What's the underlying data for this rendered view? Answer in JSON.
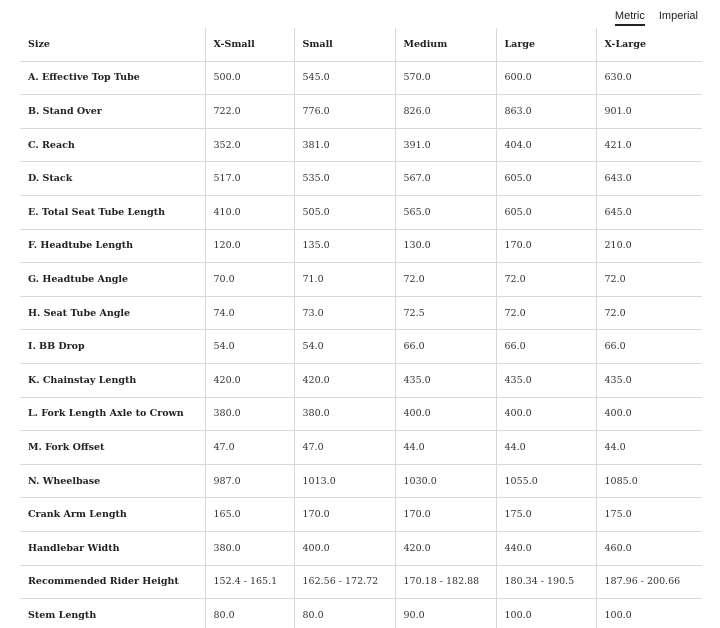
{
  "unit_toggle": {
    "metric": "Metric",
    "imperial": "Imperial",
    "selected": "Metric"
  },
  "table": {
    "header_label": "Size",
    "columns": [
      "X-Small",
      "Small",
      "Medium",
      "Large",
      "X-Large"
    ],
    "rows": [
      {
        "label": "A. Effective Top Tube",
        "values": [
          "500.0",
          "545.0",
          "570.0",
          "600.0",
          "630.0"
        ]
      },
      {
        "label": "B. Stand Over",
        "values": [
          "722.0",
          "776.0",
          "826.0",
          "863.0",
          "901.0"
        ]
      },
      {
        "label": "C. Reach",
        "values": [
          "352.0",
          "381.0",
          "391.0",
          "404.0",
          "421.0"
        ]
      },
      {
        "label": "D. Stack",
        "values": [
          "517.0",
          "535.0",
          "567.0",
          "605.0",
          "643.0"
        ]
      },
      {
        "label": "E. Total Seat Tube Length",
        "values": [
          "410.0",
          "505.0",
          "565.0",
          "605.0",
          "645.0"
        ]
      },
      {
        "label": "F. Headtube Length",
        "values": [
          "120.0",
          "135.0",
          "130.0",
          "170.0",
          "210.0"
        ]
      },
      {
        "label": "G. Headtube Angle",
        "values": [
          "70.0",
          "71.0",
          "72.0",
          "72.0",
          "72.0"
        ]
      },
      {
        "label": "H. Seat Tube Angle",
        "values": [
          "74.0",
          "73.0",
          "72.5",
          "72.0",
          "72.0"
        ]
      },
      {
        "label": "I. BB Drop",
        "values": [
          "54.0",
          "54.0",
          "66.0",
          "66.0",
          "66.0"
        ]
      },
      {
        "label": "K. Chainstay Length",
        "values": [
          "420.0",
          "420.0",
          "435.0",
          "435.0",
          "435.0"
        ]
      },
      {
        "label": "L. Fork Length Axle to Crown",
        "values": [
          "380.0",
          "380.0",
          "400.0",
          "400.0",
          "400.0"
        ]
      },
      {
        "label": "M. Fork Offset",
        "values": [
          "47.0",
          "47.0",
          "44.0",
          "44.0",
          "44.0"
        ]
      },
      {
        "label": "N. Wheelbase",
        "values": [
          "987.0",
          "1013.0",
          "1030.0",
          "1055.0",
          "1085.0"
        ]
      },
      {
        "label": "Crank Arm Length",
        "values": [
          "165.0",
          "170.0",
          "170.0",
          "175.0",
          "175.0"
        ]
      },
      {
        "label": "Handlebar Width",
        "values": [
          "380.0",
          "400.0",
          "420.0",
          "440.0",
          "460.0"
        ]
      },
      {
        "label": "Recommended Rider Height",
        "values": [
          "152.4 - 165.1",
          "162.56 - 172.72",
          "170.18 - 182.88",
          "180.34 - 190.5",
          "187.96 - 200.66"
        ]
      },
      {
        "label": "Stem Length",
        "values": [
          "80.0",
          "80.0",
          "90.0",
          "100.0",
          "100.0"
        ]
      }
    ]
  }
}
